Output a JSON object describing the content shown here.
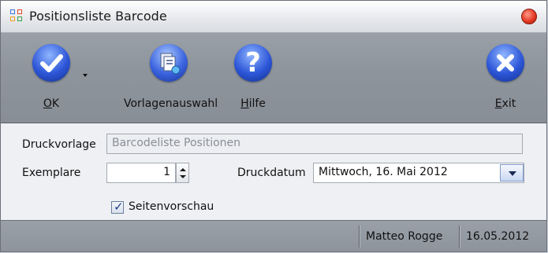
{
  "window": {
    "title": "Positionsliste Barcode"
  },
  "toolbar": {
    "ok": {
      "mnemonic": "O",
      "rest": "K",
      "icon": "checkmark-icon"
    },
    "templates": {
      "label": "Vorlagenauswahl",
      "icon": "template-select-icon"
    },
    "help": {
      "mnemonic": "H",
      "rest": "ilfe",
      "icon": "question-icon"
    },
    "exit": {
      "mnemonic": "E",
      "rest": "xit",
      "icon": "x-icon"
    }
  },
  "form": {
    "template_label": "Druckvorlage",
    "template_value": "Barcodeliste Positionen",
    "copies_label": "Exemplare",
    "copies_value": "1",
    "date_label": "Druckdatum",
    "date_value": "Mittwoch, 16. Mai 2012",
    "preview_label": "Seitenvorschau",
    "preview_checked": true
  },
  "status": {
    "user": "Matteo Rogge",
    "date": "16.05.2012"
  },
  "colors": {
    "toolbar_bg": "#8f959d",
    "icon_blue": "#2d56d8",
    "close_red": "#e43a25"
  }
}
